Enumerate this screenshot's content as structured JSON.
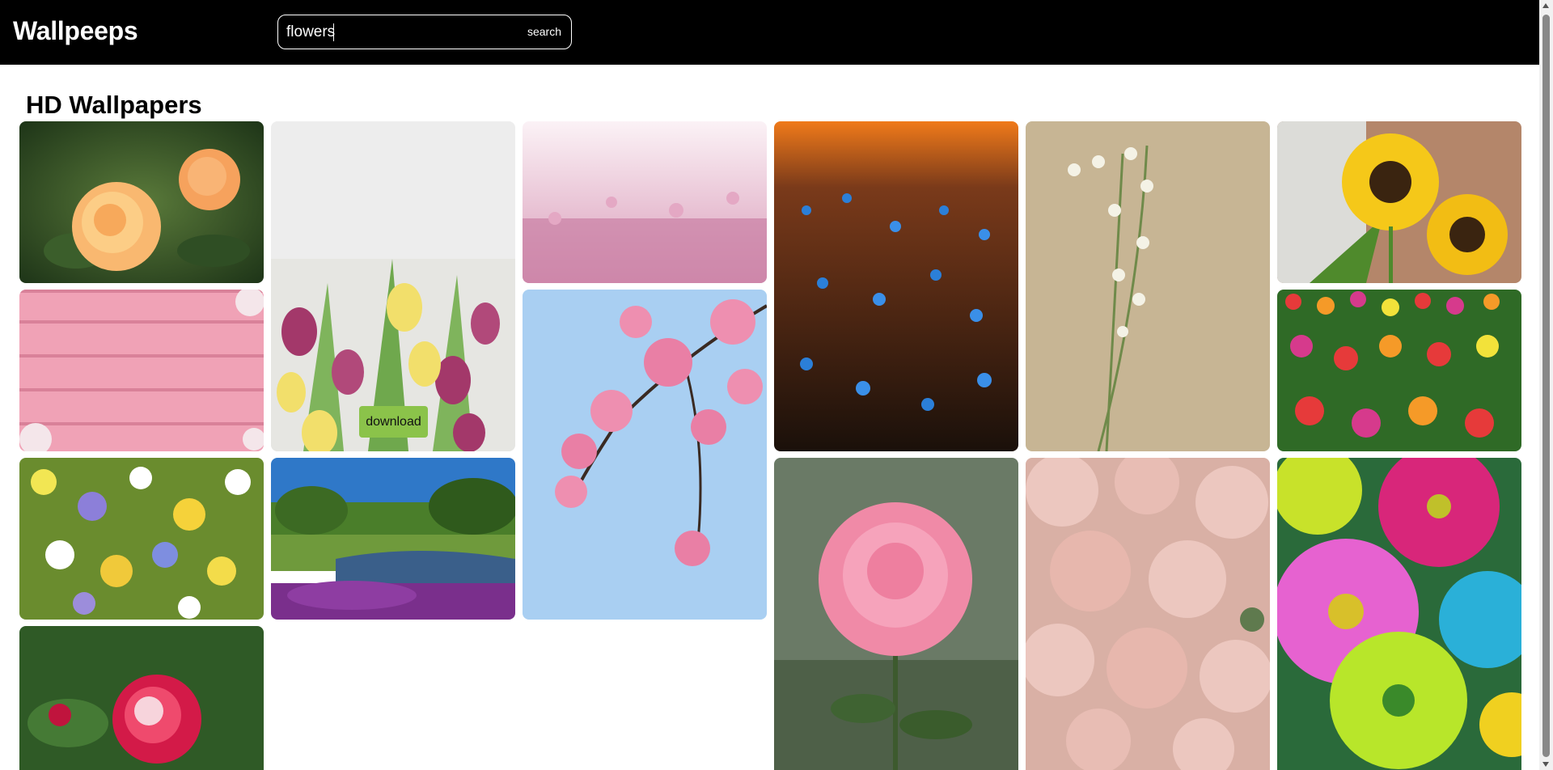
{
  "header": {
    "logo": "Wallpeeps",
    "search_value": "flowers",
    "search_placeholder": "",
    "search_button": "search"
  },
  "main": {
    "title": "HD Wallpapers",
    "download_label": "download",
    "images": [
      {
        "subject": "orange roses"
      },
      {
        "subject": "pink and yellow tulips"
      },
      {
        "subject": "pink wildflower meadow"
      },
      {
        "subject": "blue cornflowers at sunset"
      },
      {
        "subject": "lily of the valley on paper"
      },
      {
        "subject": "sunflowers by brick wall"
      },
      {
        "subject": "pink wooden boards with flowers"
      },
      {
        "subject": "cherry blossom branch"
      },
      {
        "subject": "colorful tulip field"
      },
      {
        "subject": "mixed spring wildflowers"
      },
      {
        "subject": "park lake with azaleas"
      },
      {
        "subject": "pink rose"
      },
      {
        "subject": "pink ranunculus bouquet"
      },
      {
        "subject": "colorful gerbera daisies"
      },
      {
        "subject": "red and white rose"
      }
    ]
  },
  "colors": {
    "header_bg": "#000000",
    "download_bg": "#8bc34a",
    "page_bg": "#ffffff"
  }
}
